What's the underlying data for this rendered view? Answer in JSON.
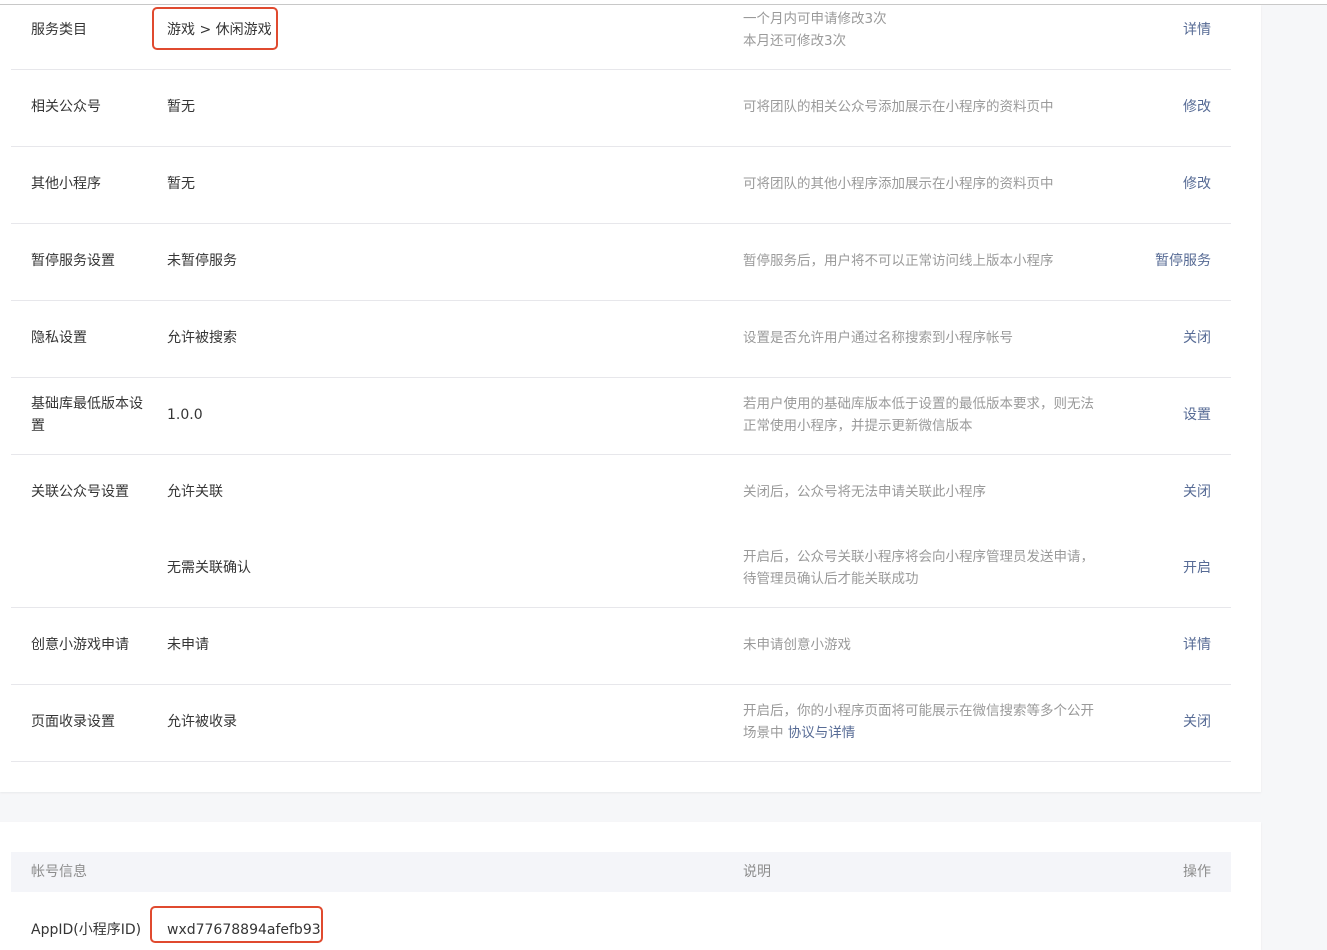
{
  "settings": {
    "service_category": {
      "label": "服务类目",
      "value": "游戏 > 休闲游戏",
      "desc_line1": "一个月内可申请修改3次",
      "desc_line2": "本月还可修改3次",
      "action": "详情"
    },
    "related_official_account": {
      "label": "相关公众号",
      "value": "暂无",
      "desc": "可将团队的相关公众号添加展示在小程序的资料页中",
      "action": "修改"
    },
    "other_mini_programs": {
      "label": "其他小程序",
      "value": "暂无",
      "desc": "可将团队的其他小程序添加展示在小程序的资料页中",
      "action": "修改"
    },
    "pause_service": {
      "label": "暂停服务设置",
      "value": "未暂停服务",
      "desc": "暂停服务后，用户将不可以正常访问线上版本小程序",
      "action": "暂停服务"
    },
    "privacy": {
      "label": "隐私设置",
      "value": "允许被搜索",
      "desc": "设置是否允许用户通过名称搜索到小程序帐号",
      "action": "关闭"
    },
    "min_lib_version": {
      "label": "基础库最低版本设置",
      "value": "1.0.0",
      "desc": "若用户使用的基础库版本低于设置的最低版本要求，则无法正常使用小程序，并提示更新微信版本",
      "action": "设置"
    },
    "link_official_account": {
      "label": "关联公众号设置",
      "value": "允许关联",
      "desc": "关闭后，公众号将无法申请关联此小程序",
      "action": "关闭"
    },
    "link_confirm": {
      "value": "无需关联确认",
      "desc": "开启后，公众号关联小程序将会向小程序管理员发送申请，待管理员确认后才能关联成功",
      "action": "开启"
    },
    "creative_game": {
      "label": "创意小游戏申请",
      "value": "未申请",
      "desc": "未申请创意小游戏",
      "action": "详情"
    },
    "page_indexing": {
      "label": "页面收录设置",
      "value": "允许被收录",
      "desc": "开启后，你的小程序页面将可能展示在微信搜索等多个公开场景中",
      "desc_link": "协议与详情",
      "action": "关闭"
    }
  },
  "account_info": {
    "header_account": "帐号信息",
    "header_desc": "说明",
    "header_action": "操作",
    "appid_label": "AppID(小程序ID)",
    "appid_value": "wxd77678894afefb93"
  },
  "colors": {
    "link": "#576b95",
    "highlight": "#e04a2f",
    "desc_text": "#9a9a9a"
  }
}
